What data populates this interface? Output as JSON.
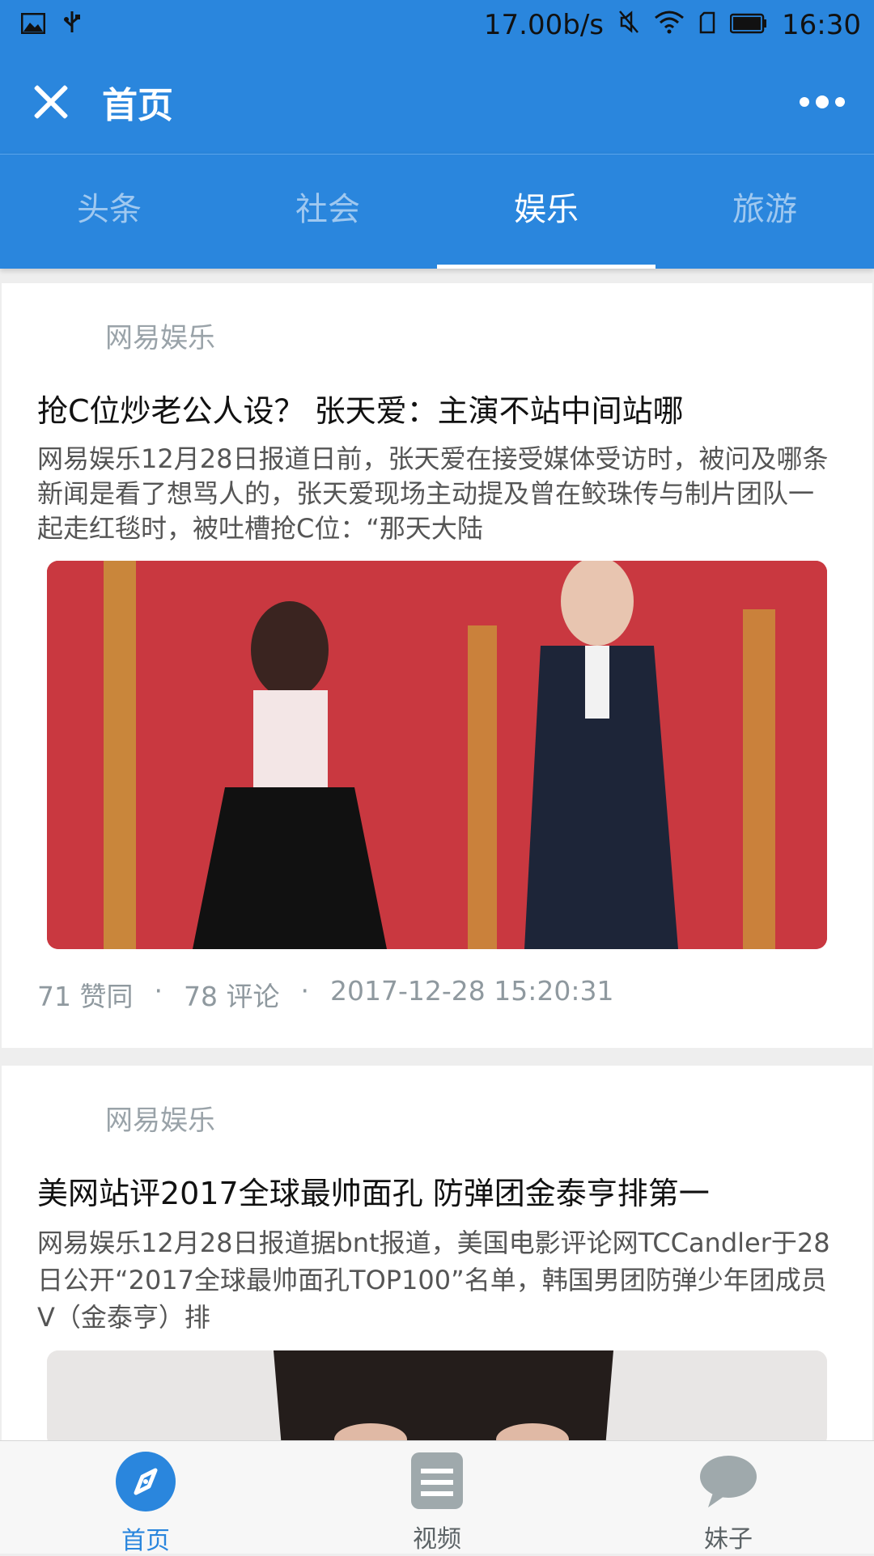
{
  "status_bar": {
    "speed": "17.00b/s",
    "time": "16:30",
    "icons": [
      "image-icon",
      "usb-icon",
      "mute-icon",
      "wifi-icon",
      "sim-icon",
      "battery-icon"
    ]
  },
  "app_bar": {
    "title": "首页",
    "close_icon": "close-icon",
    "more_icon": "more-icon"
  },
  "tabs": [
    {
      "label": "头条",
      "active": false
    },
    {
      "label": "社会",
      "active": false
    },
    {
      "label": "娱乐",
      "active": true
    },
    {
      "label": "旅游",
      "active": false
    }
  ],
  "articles": [
    {
      "source": "网易娱乐",
      "headline": "抢C位炒老公人设？ 张天爱：主演不站中间站哪",
      "summary": "网易娱乐12月28日报道日前，张天爱在接受媒体受访时，被问及哪条新闻是看了想骂人的，张天爱现场主动提及曾在鲛珠传与制片团队一起走红毯时，被吐槽抢C位：“那天大陆",
      "likes": "71 赞同",
      "comments": "78 评论",
      "time": "2017-12-28 15:20:31"
    },
    {
      "source": "网易娱乐",
      "headline": "美网站评2017全球最帅面孔 防弹团金泰亨排第一",
      "summary": "网易娱乐12月28日报道据bnt报道，美国电影评论网TCCandler于28日公开“2017全球最帅面孔TOP100”名单，韩国男团防弹少年团成员V（金泰亨）排"
    }
  ],
  "bottom_nav": [
    {
      "label": "首页",
      "icon": "compass-icon",
      "active": true
    },
    {
      "label": "视频",
      "icon": "list-icon",
      "active": false
    },
    {
      "label": "妹子",
      "icon": "chat-bubble-icon",
      "active": false
    }
  ],
  "separator": "·",
  "colors": {
    "primary": "#2a86dd",
    "text_muted": "#9aa3a9"
  }
}
